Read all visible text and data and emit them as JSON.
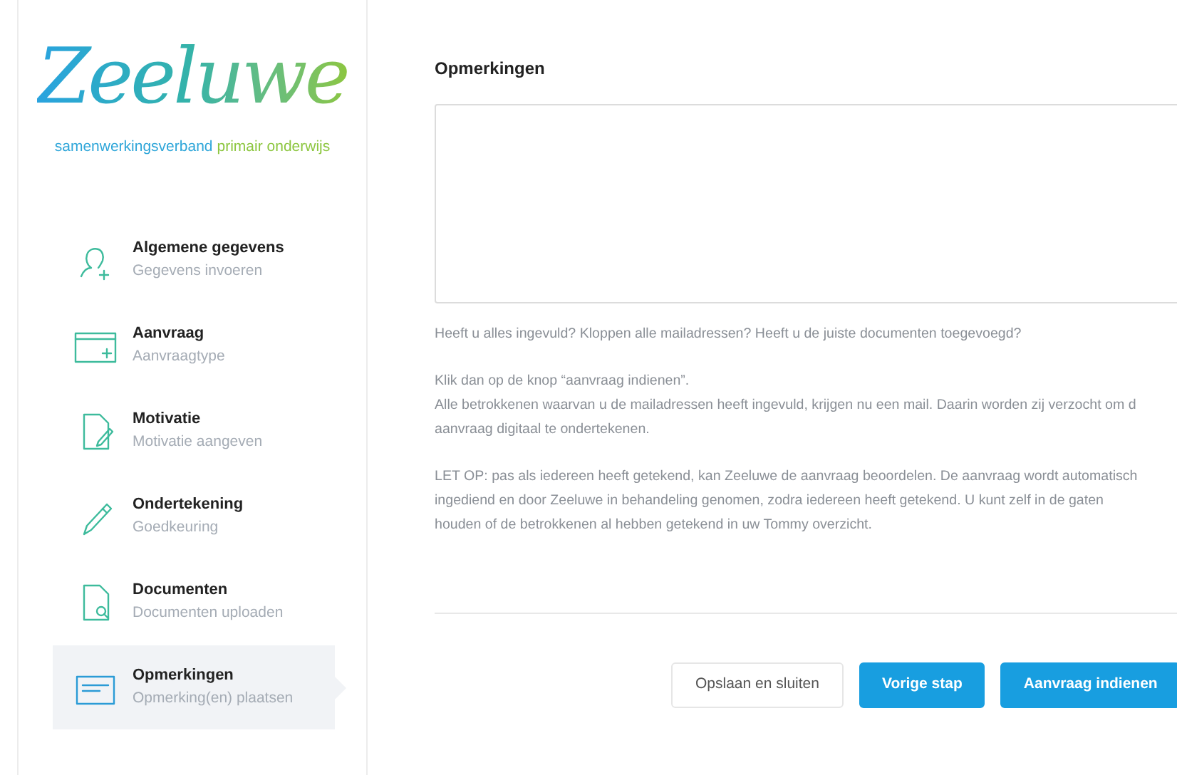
{
  "logo": {
    "name": "Zeeluwe",
    "tagline": [
      "samenwerkingsverband",
      "primair onderwijs"
    ]
  },
  "steps": [
    {
      "title": "Algemene gegevens",
      "subtitle": "Gegevens invoeren",
      "selected": false
    },
    {
      "title": "Aanvraag",
      "subtitle": "Aanvraagtype",
      "selected": false
    },
    {
      "title": "Motivatie",
      "subtitle": "Motivatie aangeven",
      "selected": false
    },
    {
      "title": "Ondertekening",
      "subtitle": "Goedkeuring",
      "selected": false
    },
    {
      "title": "Documenten",
      "subtitle": "Documenten uploaden",
      "selected": false
    },
    {
      "title": "Opmerkingen",
      "subtitle": "Opmerking(en) plaatsen",
      "selected": true
    }
  ],
  "form": {
    "heading": "Opmerkingen"
  },
  "info": [
    [
      "Heeft u alles ingevuld? Kloppen alle mailadressen? Heeft u de juiste documenten toegevoegd?"
    ],
    [
      "Klik dan op de knop “aanvraag indienen”.",
      "Alle betrokkenen waarvan u de mailadressen heeft ingevuld, krijgen nu een mail. Daarin worden zij verzocht om d",
      "aanvraag digitaal te ondertekenen."
    ],
    [
      "LET OP: pas als iedereen heeft getekend, kan Zeeluwe de aanvraag beoordelen. De aanvraag wordt automatisch",
      "ingediend en door Zeeluwe in behandeling genomen, zodra iedereen heeft getekend. U kunt zelf in de gaten",
      "houden of de betrokkenen al hebben getekend in uw Tommy overzicht."
    ]
  ],
  "buttons": [
    {
      "label": "Opslaan en sluiten",
      "kind": "secondary"
    },
    {
      "label": "Vorige stap",
      "kind": "primary"
    },
    {
      "label": "Aanvraag indienen",
      "kind": "primary"
    }
  ]
}
